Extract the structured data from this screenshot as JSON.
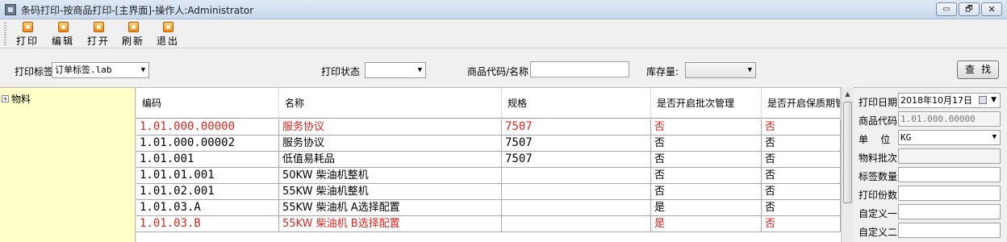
{
  "window": {
    "title": "条码打印-按商品打印-[主界面]-操作人:Administrator",
    "controls": [
      "▭",
      "🗗",
      "🗙"
    ]
  },
  "toolbar": {
    "buttons": [
      {
        "label": "打印",
        "icon": "print-icon"
      },
      {
        "label": "编辑",
        "icon": "edit-icon"
      },
      {
        "label": "打开",
        "icon": "open-icon"
      },
      {
        "label": "刷新",
        "icon": "refresh-icon"
      },
      {
        "label": "退出",
        "icon": "exit-icon"
      }
    ]
  },
  "filter": {
    "label_template": "打印标签",
    "template_value": "订单标签.lab",
    "label_print_status": "打印状态",
    "print_status_value": "",
    "label_product": "商品代码/名称",
    "product_value": "",
    "label_stock": "库存量:",
    "stock_value": "",
    "search_button": "查找"
  },
  "tree": {
    "root": {
      "expander": "+",
      "label": "物料"
    }
  },
  "grid": {
    "columns": [
      "编码",
      "名称",
      "规格",
      "是否开启批次管理",
      "是否开启保质期管理"
    ],
    "rows": [
      {
        "code": "1.01.000.00000",
        "name": "服务协议",
        "spec": "7507",
        "batch": "否",
        "shelf": "否",
        "highlight": true
      },
      {
        "code": "1.01.000.00002",
        "name": "服务协议",
        "spec": "7507",
        "batch": "否",
        "shelf": "否",
        "highlight": false
      },
      {
        "code": "1.01.001",
        "name": "低值易耗品",
        "spec": "7507",
        "batch": "否",
        "shelf": "否",
        "highlight": false
      },
      {
        "code": "1.01.01.001",
        "name": "50KW 柴油机整机",
        "spec": "",
        "batch": "否",
        "shelf": "否",
        "highlight": false
      },
      {
        "code": "1.01.02.001",
        "name": "55KW 柴油机整机",
        "spec": "",
        "batch": "否",
        "shelf": "否",
        "highlight": false
      },
      {
        "code": "1.01.03.A",
        "name": "55KW 柴油机  A选择配置",
        "spec": "",
        "batch": "是",
        "shelf": "否",
        "highlight": false
      },
      {
        "code": "1.01.03.B",
        "name": "55KW 柴油机  B选择配置",
        "spec": "",
        "batch": "是",
        "shelf": "否",
        "highlight": true
      }
    ]
  },
  "right_panel": {
    "print_date_label": "打印日期",
    "print_date_value": "2018年10月17日",
    "product_code_label": "商品代码",
    "product_code_value": "1.01.000.00000",
    "unit_label": "单    位",
    "unit_value": "KG",
    "batch_label": "物料批次",
    "batch_value": "",
    "label_qty_label": "标签数量",
    "label_qty_value": "",
    "print_copies_label": "打印份数",
    "print_copies_value": "",
    "custom1_label": "自定义一",
    "custom1_value": "",
    "custom2_label": "自定义二",
    "custom2_value": ""
  },
  "colors": {
    "highlight_text": "#e0241e",
    "tree_background": "#ffffc8"
  }
}
